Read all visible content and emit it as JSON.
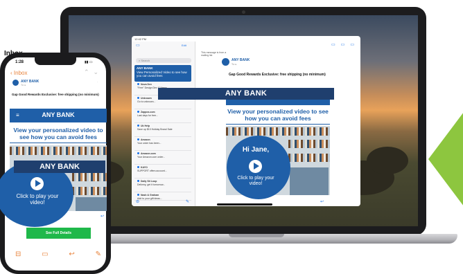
{
  "colors": {
    "brand_blue": "#1f5fa8",
    "banner_navy": "#1f3f6e",
    "cta_green": "#1fb84a",
    "accent_green": "#8dc63f",
    "mail_orange": "#e8823a"
  },
  "phone": {
    "status": {
      "time": "1:28"
    },
    "nav": {
      "back_label": "Inbox"
    },
    "header": {
      "sender": "ANY BANK"
    },
    "email": {
      "subject": "Gap Good Rewards Exclusive: free shipping (no minimum)",
      "brand": "ANY BANK",
      "headline": "View your personalized video to see how you can avoid fees",
      "overlay_banner": "ANY BANK",
      "video_cta": "Click to play your video!",
      "button_label": "See Full Details"
    },
    "toolbar": {
      "icons": [
        "archive-icon",
        "folder-icon",
        "reply-icon",
        "compose-icon"
      ]
    }
  },
  "tablet": {
    "status": {
      "time": "12:42 PM"
    },
    "sidebar": {
      "edit_label": "Edit",
      "title": "Inbox",
      "search_placeholder": "Search",
      "selected": {
        "sender": "ANY BANK",
        "preview": "View Personalized Video to see how you can avoid fees"
      },
      "items": [
        {
          "sender": "Nova Dev",
          "preview": "\"Free\" Design Dev 10 items..."
        },
        {
          "sender": "Unknown",
          "preview": "Go to unknown..."
        },
        {
          "sender": "Zappos.com",
          "preview": "Last days for free..."
        },
        {
          "sender": "Uk Help",
          "preview": "Save up $10 Holiday Brand Sale"
        },
        {
          "sender": "Amazon",
          "preview": "Your order has been..."
        },
        {
          "sender": "Amazon.com",
          "preview": "Your Amazon.com order..."
        },
        {
          "sender": "KAYO",
          "preview": "SUPPORT offers account..."
        },
        {
          "sender": "Daily Sit Loop",
          "preview": "Delivery, get it tomorrow..."
        },
        {
          "sender": "Nash & Graham",
          "preview": "Add to your gift ideas..."
        }
      ]
    },
    "email": {
      "alert": "This message is from a mailing list",
      "sender": "ANY BANK",
      "subject": "Gap Good Rewards Exclusive: free shipping (no minimum)",
      "overlay_banner": "ANY BANK",
      "headline": "View your personalized video to see how you can avoid fees",
      "greeting": "Hi Jane,",
      "video_cta": "Click to play your video!"
    }
  }
}
